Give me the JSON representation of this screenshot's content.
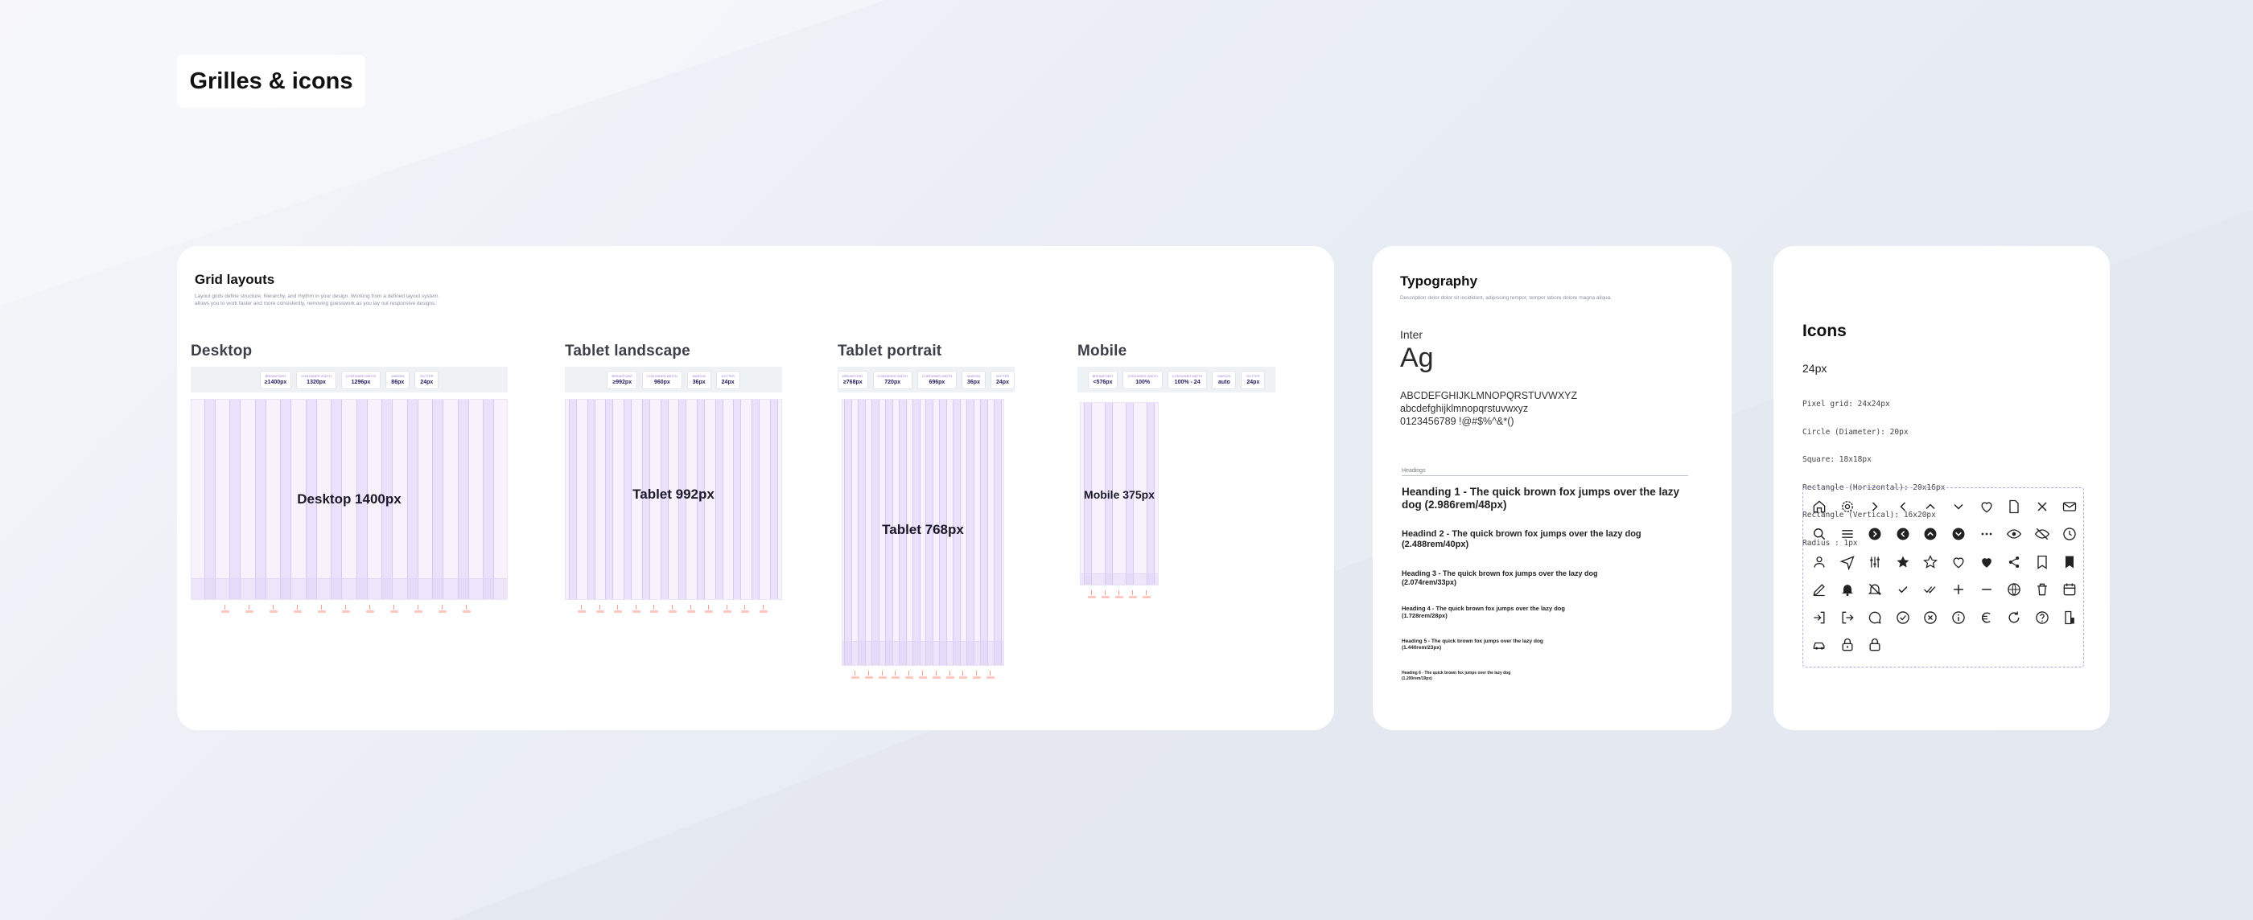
{
  "page_title": "Grilles & icons",
  "grid_card": {
    "title": "Grid layouts",
    "description": [
      "Layout grids define structure, hierarchy, and rhythm in your design. Working from a defined layout system",
      "allows you to work faster and more consistently, removing guesswork as you lay out responsive designs."
    ],
    "sections": [
      {
        "title": "Desktop",
        "frame_label": "Desktop 1400px",
        "columns": 12,
        "chips": [
          {
            "k": "Breakpoint",
            "v": "≥1400px"
          },
          {
            "k": "Container width",
            "v": "1320px"
          },
          {
            "k": "Container width",
            "v": "1296px"
          },
          {
            "k": "Margin",
            "v": "86px"
          },
          {
            "k": "Gutter",
            "v": "24px"
          }
        ]
      },
      {
        "title": "Tablet landscape",
        "frame_label": "Tablet 992px",
        "columns": 12,
        "chips": [
          {
            "k": "Breakpoint",
            "v": "≥992px"
          },
          {
            "k": "Container width",
            "v": "960px"
          },
          {
            "k": "Margin",
            "v": "36px"
          },
          {
            "k": "Gutter",
            "v": "24px"
          }
        ]
      },
      {
        "title": "Tablet portrait",
        "frame_label": "Tablet 768px",
        "columns": 12,
        "chips": [
          {
            "k": "Breakpoint",
            "v": "≥768px"
          },
          {
            "k": "Container width",
            "v": "720px"
          },
          {
            "k": "Container width",
            "v": "696px"
          },
          {
            "k": "Margin",
            "v": "36px"
          },
          {
            "k": "Gutter",
            "v": "24px"
          }
        ]
      },
      {
        "title": "Mobile",
        "frame_label": "Mobile 375px",
        "columns": 4,
        "chips": [
          {
            "k": "Breakpoint",
            "v": "<576px"
          },
          {
            "k": "Container width",
            "v": "100%"
          },
          {
            "k": "Container width",
            "v": "100% - 24"
          },
          {
            "k": "Margin",
            "v": "auto"
          },
          {
            "k": "Gutter",
            "v": "24px"
          }
        ]
      }
    ]
  },
  "typography_card": {
    "title": "Typography",
    "description": "Description dolor dolor sit incididunt, adipiscing tempor, tempor labore dolore magna aliqua.",
    "font_name": "Inter",
    "sample": "Ag",
    "glyphs": [
      "ABCDEFGHIJKLMNOPQRSTUVWXYZ",
      "abcdefghijklmnopqrstuvwxyz",
      "0123456789 !@#$%^&*()"
    ],
    "headings_label": "Headings",
    "headings": [
      "Heanding 1 - The quick brown fox jumps over the lazy dog (2.986rem/48px)",
      "Headind 2 - The quick brown fox jumps over the lazy dog (2.488rem/40px)",
      "Heading 3 - The quick brown fox jumps over the lazy dog (2.074rem/33px)",
      "Heading 4 - The quick brown fox jumps over the lazy dog (1.728rem/28px)",
      "Heading 5 - The quick brown fox jumps over the lazy dog (1.440rem/23px)",
      "Heading 6 - The quick brown fox jumps over the lazy dog (1.200rem/19px)"
    ]
  },
  "icons_card": {
    "title": "Icons",
    "size_label": "24px",
    "spec": [
      "Pixel grid: 24x24px",
      "Circle (Diameter): 20px",
      "Square: 18x18px",
      "Rectangle (Horizontal): 20x16px",
      "Rectangle (Vertical): 16x20px",
      "Radius : 1px"
    ],
    "icons": [
      "home-icon",
      "settings-icon",
      "chevron-right-icon",
      "chevron-left-icon",
      "chevron-up-icon",
      "chevron-down-icon",
      "heart-icon",
      "file-icon",
      "close-icon",
      "mail-icon",
      "search-icon",
      "menu-icon",
      "arrow-circle-right-icon",
      "arrow-circle-left-icon",
      "arrow-circle-up-icon",
      "arrow-circle-down-icon",
      "more-horizontal-icon",
      "eye-icon",
      "eye-off-icon",
      "clock-icon",
      "user-icon",
      "send-icon",
      "sliders-icon",
      "star-filled-icon",
      "star-icon",
      "heart-outline-icon",
      "heart-filled-icon",
      "share-icon",
      "bookmark-icon",
      "bookmark-filled-icon",
      "edit-icon",
      "bell-icon",
      "bell-off-icon",
      "check-icon",
      "check-double-icon",
      "plus-icon",
      "minus-icon",
      "globe-icon",
      "trash-icon",
      "calendar-icon",
      "login-icon",
      "logout-icon",
      "chat-icon",
      "check-circle-icon",
      "x-circle-icon",
      "info-icon",
      "euro-icon",
      "refresh-icon",
      "help-icon",
      "receipt-icon",
      "car-icon",
      "lock-icon",
      "lock-closed-icon"
    ]
  },
  "colors": {
    "accent": "#a07ad0",
    "column": "#ebe1fa",
    "marker": "#ff9b8f"
  }
}
